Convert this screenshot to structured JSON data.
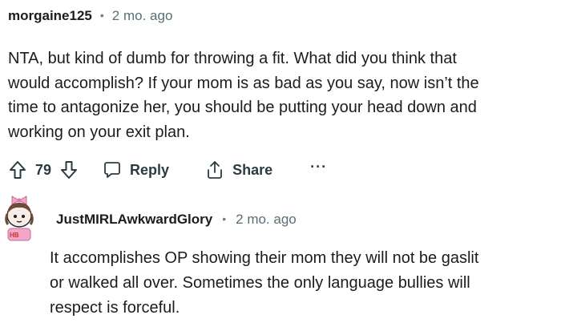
{
  "comment": {
    "username": "morgaine125",
    "separator": "•",
    "timestamp": "2 mo. ago",
    "body_lines": [
      "NTA, but kind of dumb for throwing a fit. What did you think that",
      "would accomplish? If your mom is as bad as you say, now isn’t the",
      "time to antagonize her, you should be putting your head down and",
      "working on your exit plan."
    ],
    "actions": {
      "upvote_icon": "upvote-arrow-icon",
      "vote_count": "79",
      "downvote_icon": "downvote-arrow-icon",
      "reply_icon": "speech-bubble-icon",
      "reply_label": "Reply",
      "share_icon": "share-upload-icon",
      "share_label": "Share",
      "more_label": "···"
    }
  },
  "reply": {
    "avatar_icon": "avatar-character-icon",
    "username": "JustMIRLAwkwardGlory",
    "separator": "•",
    "timestamp": "2 mo. ago",
    "body_lines": [
      "It accomplishes OP showing their mom they will not be gaslit",
      "or walked all over. Sometimes the only language bullies will",
      "respect is forceful."
    ]
  },
  "colors": {
    "text": "#1c1c1c",
    "meta": "#576f76",
    "action": "#2a3c42",
    "avatar_bow": "#f4a6c6"
  }
}
